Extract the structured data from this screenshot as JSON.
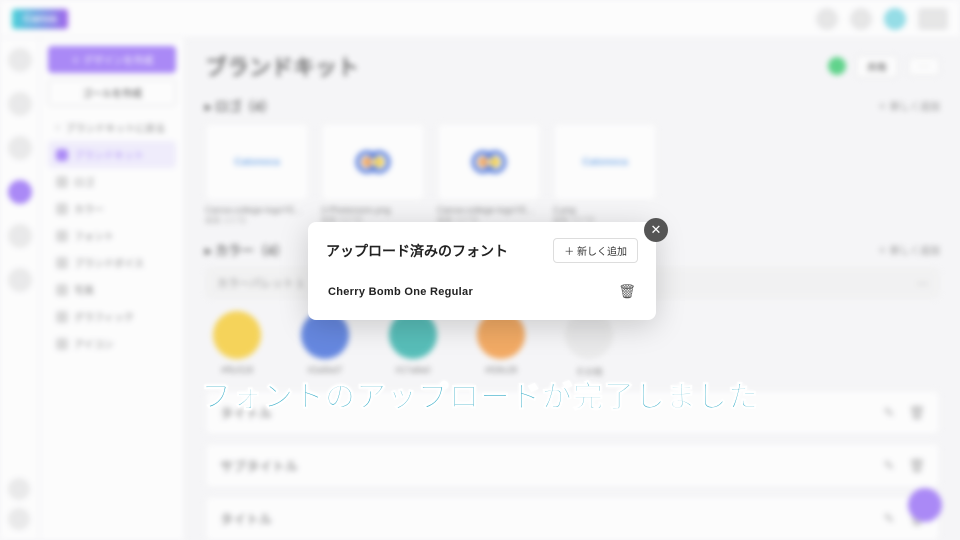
{
  "header": {
    "logo_text": "Canva"
  },
  "sidebar": {
    "primary_btn": "＋ デザインを作成",
    "secondary_btn": "ゴールを作成",
    "items": [
      {
        "label": "ブランドキットに戻る"
      },
      {
        "label": "ブランドキット"
      },
      {
        "label": "ロゴ"
      },
      {
        "label": "カラー"
      },
      {
        "label": "フォント"
      },
      {
        "label": "ブランドボイス"
      },
      {
        "label": "写真"
      },
      {
        "label": "グラフィック"
      },
      {
        "label": "アイコン"
      }
    ]
  },
  "main": {
    "title": "ブランドキット",
    "share_pill": "共有",
    "logo_section": {
      "heading": "ロゴ（4）",
      "link": "＋ 新しく追加"
    },
    "logos": [
      {
        "name": "Canva-college-logoYE...",
        "meta": "編集 1/17日",
        "text": "Catonoca"
      },
      {
        "name": "2-Photoroom.png",
        "meta": "編集 1/17日",
        "svg": true
      },
      {
        "name": "Canva-college-logoYE...",
        "meta": "編集 1/17日",
        "svg": true
      },
      {
        "name": "2.png",
        "meta": "編集 1/17日",
        "text": "Catonoca"
      }
    ],
    "color_section": {
      "heading": "カラー（4）",
      "link": "＋ 新しく追加"
    },
    "palette_bar": "カラーパレット 1",
    "swatches": [
      {
        "label": "#f5c518",
        "color": "#f5c518"
      },
      {
        "label": "#2a5bd7",
        "color": "#2a5bd7"
      },
      {
        "label": "#17a8a0",
        "color": "#17a8a0"
      },
      {
        "label": "#f28c28",
        "color": "#f28c28"
      },
      {
        "label": "その他",
        "color": "#e5e5e5"
      }
    ],
    "font_rows": [
      "タイトル",
      "サブタイトル",
      "タイトル"
    ]
  },
  "modal": {
    "title": "アップロード済みのフォント",
    "add_btn": "＋ 新しく追加",
    "font_name": "Cherry Bomb One Regular"
  },
  "caption": "フォントのアップロードが完了しました"
}
